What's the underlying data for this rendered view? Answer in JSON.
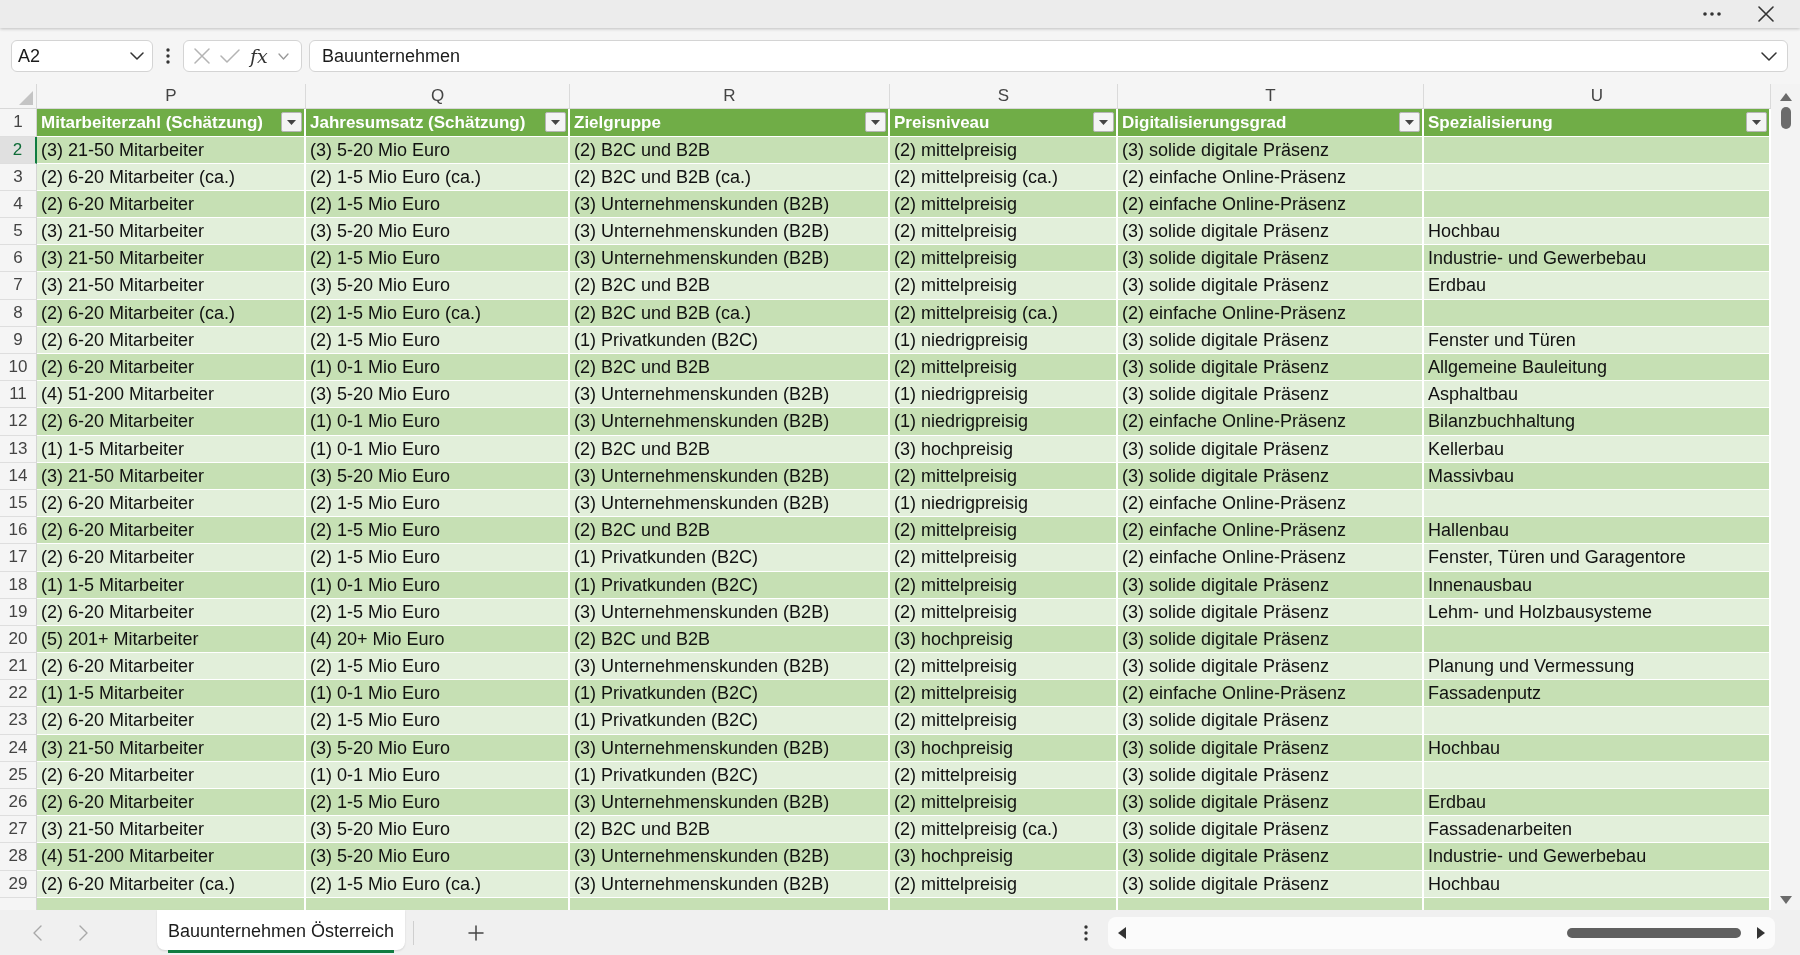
{
  "formula_bar": {
    "name_box": "A2",
    "cancel_button": {
      "disabled": true
    },
    "enter_button": {
      "disabled": true
    },
    "function_button": "fx",
    "formula": "Bauunternehmen"
  },
  "sheet": {
    "column_letters": [
      "P",
      "Q",
      "R",
      "S",
      "T",
      "U"
    ],
    "header_row_number": "1",
    "headers": [
      "Mitarbeiterzahl (Schätzung)",
      "Jahresumsatz (Schätzung)",
      "Zielgruppe",
      "Preisniveau",
      "Digitalisierungsgrad",
      "Spezialisierung"
    ],
    "rows": [
      {
        "number": "2",
        "selected": true,
        "cells": [
          "(3) 21-50 Mitarbeiter",
          "(3) 5-20 Mio Euro",
          "(2) B2C und B2B",
          "(2) mittelpreisig",
          "(3) solide digitale Präsenz"
        ]
      },
      {
        "number": "3",
        "selected": false,
        "cells": [
          "(2) 6-20 Mitarbeiter (ca.)",
          "(2) 1-5 Mio Euro (ca.)",
          "(2) B2C und B2B (ca.)",
          "(2) mittelpreisig (ca.)",
          "(2) einfache Online-Präsenz"
        ]
      },
      {
        "number": "4",
        "selected": false,
        "cells": [
          "(2) 6-20 Mitarbeiter",
          "(2) 1-5 Mio Euro",
          "(3) Unternehmenskunden (B2B)",
          "(2) mittelpreisig",
          "(2) einfache Online-Präsenz"
        ]
      },
      {
        "number": "5",
        "selected": false,
        "cells": [
          "(3) 21-50 Mitarbeiter",
          "(3) 5-20 Mio Euro",
          "(3) Unternehmenskunden (B2B)",
          "(2) mittelpreisig",
          "(3) solide digitale Präsenz",
          "Hochbau"
        ]
      },
      {
        "number": "6",
        "selected": false,
        "cells": [
          "(3) 21-50 Mitarbeiter",
          "(2) 1-5 Mio Euro",
          "(3) Unternehmenskunden (B2B)",
          "(2) mittelpreisig",
          "(3) solide digitale Präsenz",
          "Industrie- und Gewerbebau"
        ]
      },
      {
        "number": "7",
        "selected": false,
        "cells": [
          "(3) 21-50 Mitarbeiter",
          "(3) 5-20 Mio Euro",
          "(2) B2C und B2B",
          "(2) mittelpreisig",
          "(3) solide digitale Präsenz",
          "Erdbau"
        ]
      },
      {
        "number": "8",
        "selected": false,
        "cells": [
          "(2) 6-20 Mitarbeiter (ca.)",
          "(2) 1-5 Mio Euro (ca.)",
          "(2) B2C und B2B (ca.)",
          "(2) mittelpreisig (ca.)",
          "(2) einfache Online-Präsenz"
        ]
      },
      {
        "number": "9",
        "selected": false,
        "cells": [
          "(2) 6-20 Mitarbeiter",
          "(2) 1-5 Mio Euro",
          "(1) Privatkunden (B2C)",
          "(1) niedrigpreisig",
          "(3) solide digitale Präsenz",
          "Fenster und Türen"
        ]
      },
      {
        "number": "10",
        "selected": false,
        "cells": [
          "(2) 6-20 Mitarbeiter",
          "(1) 0-1 Mio Euro",
          "(2) B2C und B2B",
          "(2) mittelpreisig",
          "(3) solide digitale Präsenz",
          "Allgemeine Bauleitung"
        ]
      },
      {
        "number": "11",
        "selected": false,
        "cells": [
          "(4) 51-200 Mitarbeiter",
          "(3) 5-20 Mio Euro",
          "(3) Unternehmenskunden (B2B)",
          "(1) niedrigpreisig",
          "(3) solide digitale Präsenz",
          "Asphaltbau"
        ]
      },
      {
        "number": "12",
        "selected": false,
        "cells": [
          "(2) 6-20 Mitarbeiter",
          "(1) 0-1 Mio Euro",
          "(3) Unternehmenskunden (B2B)",
          "(1) niedrigpreisig",
          "(2) einfache Online-Präsenz",
          "Bilanzbuchhaltung"
        ]
      },
      {
        "number": "13",
        "selected": false,
        "cells": [
          "(1) 1-5 Mitarbeiter",
          "(1) 0-1 Mio Euro",
          "(2) B2C und B2B",
          "(3) hochpreisig",
          "(3) solide digitale Präsenz",
          "Kellerbau"
        ]
      },
      {
        "number": "14",
        "selected": false,
        "cells": [
          "(3) 21-50 Mitarbeiter",
          "(3) 5-20 Mio Euro",
          "(3) Unternehmenskunden (B2B)",
          "(2) mittelpreisig",
          "(3) solide digitale Präsenz",
          "Massivbau"
        ]
      },
      {
        "number": "15",
        "selected": false,
        "cells": [
          "(2) 6-20 Mitarbeiter",
          "(2) 1-5 Mio Euro",
          "(3) Unternehmenskunden (B2B)",
          "(1) niedrigpreisig",
          "(2) einfache Online-Präsenz"
        ]
      },
      {
        "number": "16",
        "selected": false,
        "cells": [
          "(2) 6-20 Mitarbeiter",
          "(2) 1-5 Mio Euro",
          "(2) B2C und B2B",
          "(2) mittelpreisig",
          "(2) einfache Online-Präsenz",
          "Hallenbau"
        ]
      },
      {
        "number": "17",
        "selected": false,
        "cells": [
          "(2) 6-20 Mitarbeiter",
          "(2) 1-5 Mio Euro",
          "(1) Privatkunden (B2C)",
          "(2) mittelpreisig",
          "(2) einfache Online-Präsenz",
          "Fenster, Türen und Garagentore"
        ]
      },
      {
        "number": "18",
        "selected": false,
        "cells": [
          "(1) 1-5 Mitarbeiter",
          "(1) 0-1 Mio Euro",
          "(1) Privatkunden (B2C)",
          "(2) mittelpreisig",
          "(3) solide digitale Präsenz",
          "Innenausbau"
        ]
      },
      {
        "number": "19",
        "selected": false,
        "cells": [
          "(2) 6-20 Mitarbeiter",
          "(2) 1-5 Mio Euro",
          "(3) Unternehmenskunden (B2B)",
          "(2) mittelpreisig",
          "(3) solide digitale Präsenz",
          "Lehm- und Holzbausysteme"
        ]
      },
      {
        "number": "20",
        "selected": false,
        "cells": [
          "(5) 201+ Mitarbeiter",
          "(4) 20+ Mio Euro",
          "(2) B2C und B2B",
          "(3) hochpreisig",
          "(3) solide digitale Präsenz"
        ]
      },
      {
        "number": "21",
        "selected": false,
        "cells": [
          "(2) 6-20 Mitarbeiter",
          "(2) 1-5 Mio Euro",
          "(3) Unternehmenskunden (B2B)",
          "(2) mittelpreisig",
          "(3) solide digitale Präsenz",
          "Planung und Vermessung"
        ]
      },
      {
        "number": "22",
        "selected": false,
        "cells": [
          "(1) 1-5 Mitarbeiter",
          "(1) 0-1 Mio Euro",
          "(1) Privatkunden (B2C)",
          "(2) mittelpreisig",
          "(2) einfache Online-Präsenz",
          "Fassadenputz"
        ]
      },
      {
        "number": "23",
        "selected": false,
        "cells": [
          "(2) 6-20 Mitarbeiter",
          "(2) 1-5 Mio Euro",
          "(1) Privatkunden (B2C)",
          "(2) mittelpreisig",
          "(3) solide digitale Präsenz"
        ]
      },
      {
        "number": "24",
        "selected": false,
        "cells": [
          "(3) 21-50 Mitarbeiter",
          "(3) 5-20 Mio Euro",
          "(3) Unternehmenskunden (B2B)",
          "(3) hochpreisig",
          "(3) solide digitale Präsenz",
          "Hochbau"
        ]
      },
      {
        "number": "25",
        "selected": false,
        "cells": [
          "(2) 6-20 Mitarbeiter",
          "(1) 0-1 Mio Euro",
          "(1) Privatkunden (B2C)",
          "(2) mittelpreisig",
          "(3) solide digitale Präsenz"
        ]
      },
      {
        "number": "26",
        "selected": false,
        "cells": [
          "(2) 6-20 Mitarbeiter",
          "(2) 1-5 Mio Euro",
          "(3) Unternehmenskunden (B2B)",
          "(2) mittelpreisig",
          "(3) solide digitale Präsenz",
          "Erdbau"
        ]
      },
      {
        "number": "27",
        "selected": false,
        "cells": [
          "(3) 21-50 Mitarbeiter",
          "(3) 5-20 Mio Euro",
          "(2) B2C und B2B",
          "(2) mittelpreisig (ca.)",
          "(3) solide digitale Präsenz",
          "Fassadenarbeiten"
        ]
      },
      {
        "number": "28",
        "selected": false,
        "cells": [
          "(4) 51-200 Mitarbeiter",
          "(3) 5-20 Mio Euro",
          "(3) Unternehmenskunden (B2B)",
          "(3) hochpreisig",
          "(3) solide digitale Präsenz",
          "Industrie- und Gewerbebau"
        ]
      },
      {
        "number": "29",
        "selected": false,
        "cells": [
          "(2) 6-20 Mitarbeiter (ca.)",
          "(2) 1-5 Mio Euro (ca.)",
          "(3) Unternehmenskunden (B2B)",
          "(2) mittelpreisig",
          "(3) solide digitale Präsenz",
          "Hochbau"
        ]
      }
    ]
  },
  "sheet_navigation": {
    "previous": {
      "disabled": true
    },
    "next": {
      "disabled": true
    }
  },
  "sheet_tabs": [
    {
      "label": "Bauunternehmen Österreich",
      "selected": true
    }
  ]
}
